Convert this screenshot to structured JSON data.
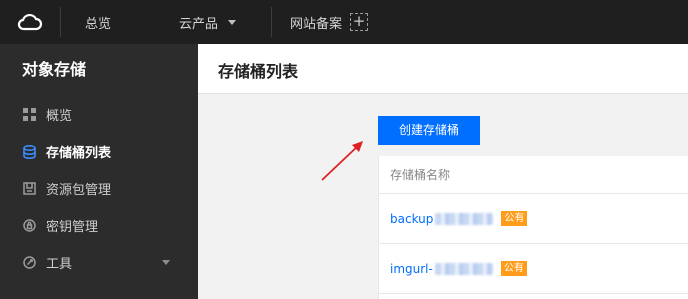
{
  "topbar": {
    "logo_icon": "cloud-logo-icon",
    "overview": "总览",
    "products": "云产品",
    "record": "网站备案",
    "add_icon": "+"
  },
  "sidebar": {
    "title": "对象存储",
    "items": [
      {
        "label": "概览",
        "icon": "grid-icon"
      },
      {
        "label": "存储桶列表",
        "icon": "database-icon"
      },
      {
        "label": "资源包管理",
        "icon": "package-icon"
      },
      {
        "label": "密钥管理",
        "icon": "lock-icon"
      },
      {
        "label": "工具",
        "icon": "wrench-icon"
      }
    ]
  },
  "main": {
    "title": "存储桶列表",
    "create_button": "创建存储桶",
    "table": {
      "header": "存储桶名称",
      "rows": [
        {
          "name": "backup",
          "badge": "公有"
        },
        {
          "name": "imgurl-",
          "badge": "公有"
        }
      ]
    }
  },
  "colors": {
    "accent": "#006eff",
    "badge": "#ff9c19",
    "annotation_arrow": "#e02020"
  }
}
